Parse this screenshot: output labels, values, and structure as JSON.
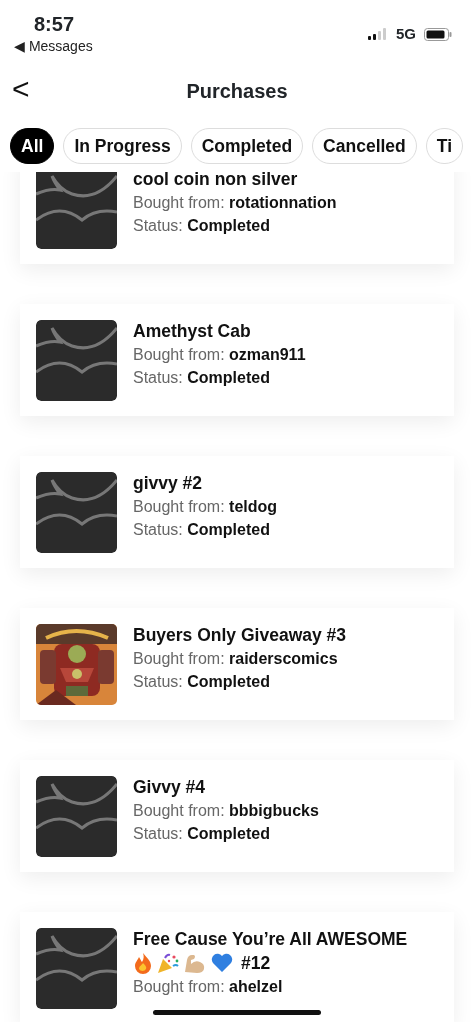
{
  "status_bar": {
    "time": "8:57",
    "back_app": "◀ Messages",
    "network": "5G"
  },
  "header": {
    "back": "<",
    "title": "Purchases"
  },
  "filters": [
    {
      "label": "All",
      "selected": true
    },
    {
      "label": "In Progress",
      "selected": false
    },
    {
      "label": "Completed",
      "selected": false
    },
    {
      "label": "Cancelled",
      "selected": false
    },
    {
      "label": "Ti",
      "selected": false
    }
  ],
  "purchases": [
    {
      "thumbnail": {
        "kind": "placeholder"
      },
      "title": "cool coin non silver",
      "seller_label": "Bought from:",
      "seller": "rotationnation",
      "status_label": "Status:",
      "status": "Completed"
    },
    {
      "thumbnail": {
        "kind": "placeholder"
      },
      "title": "Amethyst Cab",
      "seller_label": "Bought from:",
      "seller": "ozman911",
      "status_label": "Status:",
      "status": "Completed"
    },
    {
      "thumbnail": {
        "kind": "placeholder"
      },
      "title": "givvy #2",
      "seller_label": "Bought from:",
      "seller": "teldog",
      "status_label": "Status:",
      "status": "Completed"
    },
    {
      "title": "Buyers Only Giveaway #3",
      "seller_label": "Bought from:",
      "seller": "raiderscomics",
      "status_label": "Status:",
      "status": "Completed"
    },
    {
      "thumbnail": {
        "kind": "placeholder"
      },
      "title": "Givvy #4",
      "seller_label": "Bought from:",
      "seller": "bbbigbucks",
      "status_label": "Status:",
      "status": "Completed"
    },
    {
      "thumbnail": {
        "kind": "placeholder"
      },
      "title": "Free Cause You’re All AWESOME",
      "title_suffix": "#12",
      "seller_label": "Bought from:",
      "seller": "ahelzel"
    }
  ]
}
